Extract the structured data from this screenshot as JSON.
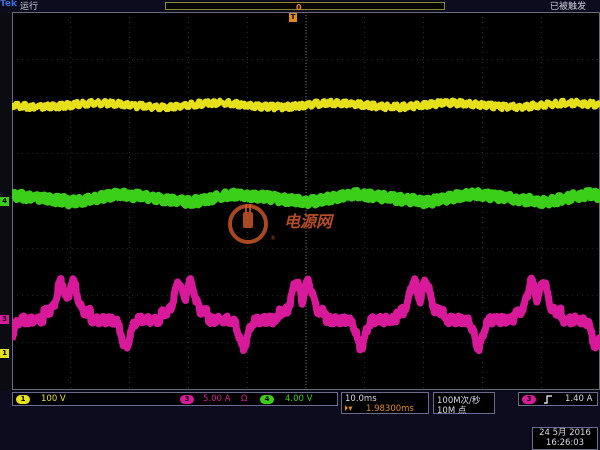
{
  "header": {
    "brand": "Tek",
    "acq_state": "运行",
    "trigger_state": "已被触发",
    "trigger_position_marker": "0",
    "trigger_marker": "T"
  },
  "channels": {
    "ch1": {
      "label": "1",
      "scale": "100 V",
      "color": "#e6e01a"
    },
    "ch3": {
      "label": "3",
      "scale": "5.00 A",
      "unit_symbol": "Ω",
      "color": "#d81a9a"
    },
    "ch4": {
      "label": "4",
      "scale": "4.00 V",
      "color": "#3ccf1a"
    }
  },
  "timebase": {
    "scale": "10.0ms",
    "delay": "1.98300ms"
  },
  "sampling": {
    "rate": "100M次/秒",
    "points": "10M 点"
  },
  "trigger": {
    "source": "3",
    "slope_icon": "rising-edge",
    "level": "1.40 A"
  },
  "datetime": {
    "date": "24 5月 2016",
    "time": "16:26:03"
  },
  "watermark": {
    "text": "电源网",
    "reg": "®"
  },
  "colors": {
    "grid": "#4a4a5a",
    "background": "#000000",
    "accent": "#e08a1a"
  }
}
